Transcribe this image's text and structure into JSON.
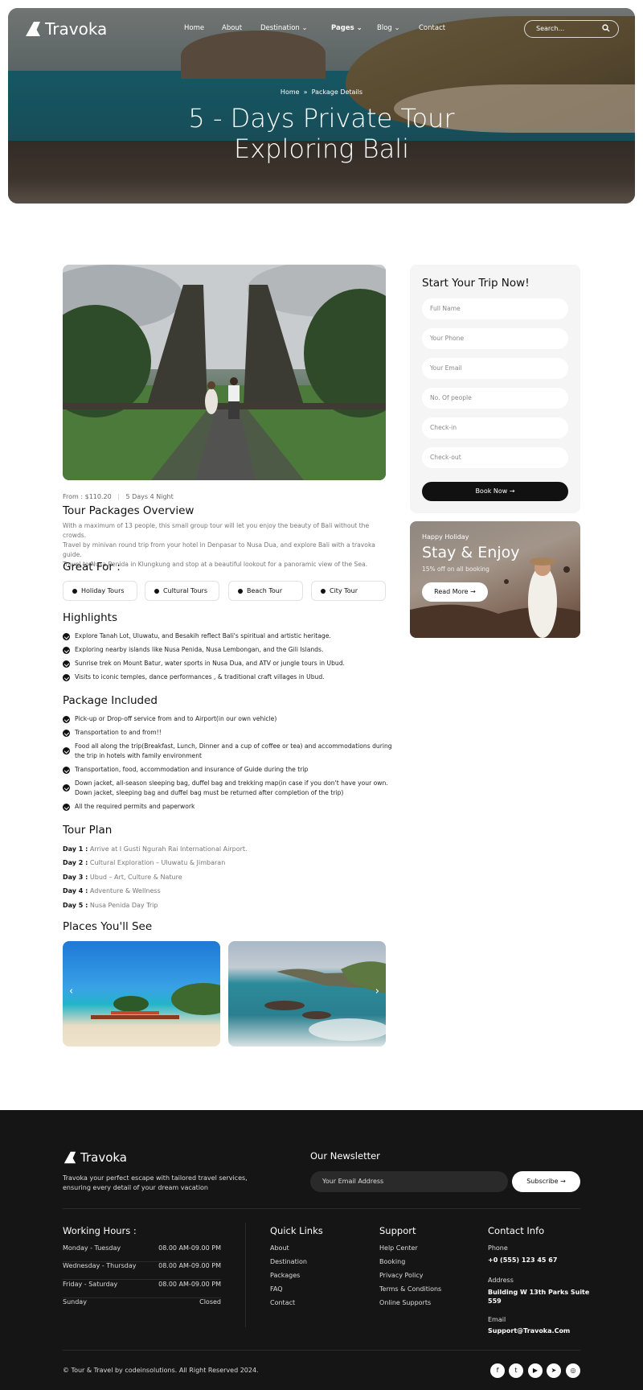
{
  "brand": {
    "name": "Travoka"
  },
  "nav": {
    "items": [
      "Home",
      "About",
      "Destination",
      "Pages",
      "Blog",
      "Contact"
    ],
    "search_placeholder": "Search..."
  },
  "hero": {
    "breadcrumb_home": "Home",
    "breadcrumb_current": "Package Details",
    "title_line1": "5 - Days Private Tour",
    "title_line2": "Exploring Bali"
  },
  "package": {
    "price": "From : $110.20",
    "duration": "5 Days 4 Night",
    "overview_title": "Tour Packages Overview",
    "overview_text": [
      "With a maximum of 13 people, this small group tour will let you enjoy the beauty of Bali without the crowds.",
      "Travel by minivan round trip from your hotel in Denpasar to Nusa Dua, and explore Bali with a travoka guide.",
      "Travel to Nusa Penida in Klungkung and stop at a beautiful lookout for a panoramic view of the Sea."
    ],
    "great_for_title": "Great For :",
    "great_for": [
      "Holiday Tours",
      "Cultural Tours",
      "Beach Tour",
      "City Tour"
    ],
    "highlights_title": "Highlights",
    "highlights": [
      "Explore Tanah Lot, Uluwatu, and Besakih reflect Bali's spiritual and artistic heritage.",
      "Exploring nearby islands like Nusa Penida, Nusa Lembongan, and the Gili Islands.",
      "Sunrise trek on Mount Batur, water sports in Nusa Dua, and ATV or jungle tours in Ubud.",
      "Visits to iconic temples, dance performances , & traditional craft villages in Ubud."
    ],
    "included_title": "Package Included",
    "included": [
      [
        "Pick-up or Drop-off service from and to Airport(in our own vehicle)"
      ],
      [
        "Transportation to and from!!"
      ],
      [
        "Food all along the trip(Breakfast, Lunch, Dinner and a cup of coffee or tea) and accommodations during",
        "the trip in hotels with family environment"
      ],
      [
        "Transportation, food, accommodation and insurance of Guide during the trip"
      ],
      [
        "Down jacket, all-season sleeping bag, duffel bag and trekking map(in case if you don't have your own.",
        "Down jacket, sleeping bag and duffel bag must be returned after completion of the trip)"
      ],
      [
        "All the required permits and paperwork"
      ]
    ],
    "plan_title": "Tour Plan",
    "plan": [
      {
        "day": "Day 1 :",
        "text": "Arrive at I Gusti Ngurah Rai International Airport."
      },
      {
        "day": "Day 2 :",
        "text": "Cultural Exploration – Uluwatu & Jimbaran"
      },
      {
        "day": "Day 3 :",
        "text": "Ubud – Art, Culture & Nature"
      },
      {
        "day": "Day 4 :",
        "text": "Adventure & Wellness"
      },
      {
        "day": "Day 5 :",
        "text": "Nusa Penida Day Trip"
      }
    ],
    "places_title": "Places You'll See"
  },
  "booking": {
    "title": "Start Your Trip Now!",
    "fields": [
      "Full Name",
      "Your Phone",
      "Your Email",
      "No. Of people",
      "Check-in",
      "Check-out"
    ],
    "button": "Book Now"
  },
  "promo": {
    "eyebrow": "Happy Holiday",
    "title": "Stay & Enjoy",
    "subtitle": "15% off on all booking",
    "button": "Read More"
  },
  "footer": {
    "tagline_line1": "Travoka your perfect escape with tailored travel services,",
    "tagline_line2": "ensuring every detail of your dream vacation",
    "newsletter_title": "Our Newsletter",
    "newsletter_placeholder": "Your Email Address",
    "subscribe": "Subscribe",
    "hours_title": "Working Hours :",
    "hours": [
      {
        "day": "Monday - Tuesday",
        "time": "08.00 AM-09.00 PM"
      },
      {
        "day": "Wednesday - Thursday",
        "time": "08.00 AM-09.00 PM"
      },
      {
        "day": "Friday - Saturday",
        "time": "08.00 AM-09.00 PM"
      },
      {
        "day": "Sunday",
        "time": "Closed"
      }
    ],
    "quick_title": "Quick Links",
    "quick": [
      "About",
      "Destination",
      "Packages",
      "FAQ",
      "Contact"
    ],
    "support_title": "Support",
    "support": [
      "Help Center",
      "Booking",
      "Privacy Policy",
      "Terms & Conditions",
      "Online Supports"
    ],
    "contact_title": "Contact Info",
    "phone_label": "Phone",
    "phone": "+0 (555) 123 45 67",
    "address_label": "Address",
    "address_line1": "Building W 13th Parks Suite",
    "address_line2": "559",
    "email_label": "Email",
    "email": "Support@Travoka.Com",
    "copyright": "© Tour & Travel by codeinsolutions. All Right Reserved 2024.",
    "social": [
      "facebook-icon",
      "twitter-icon",
      "youtube-icon",
      "telegram-icon",
      "instagram-icon"
    ]
  }
}
